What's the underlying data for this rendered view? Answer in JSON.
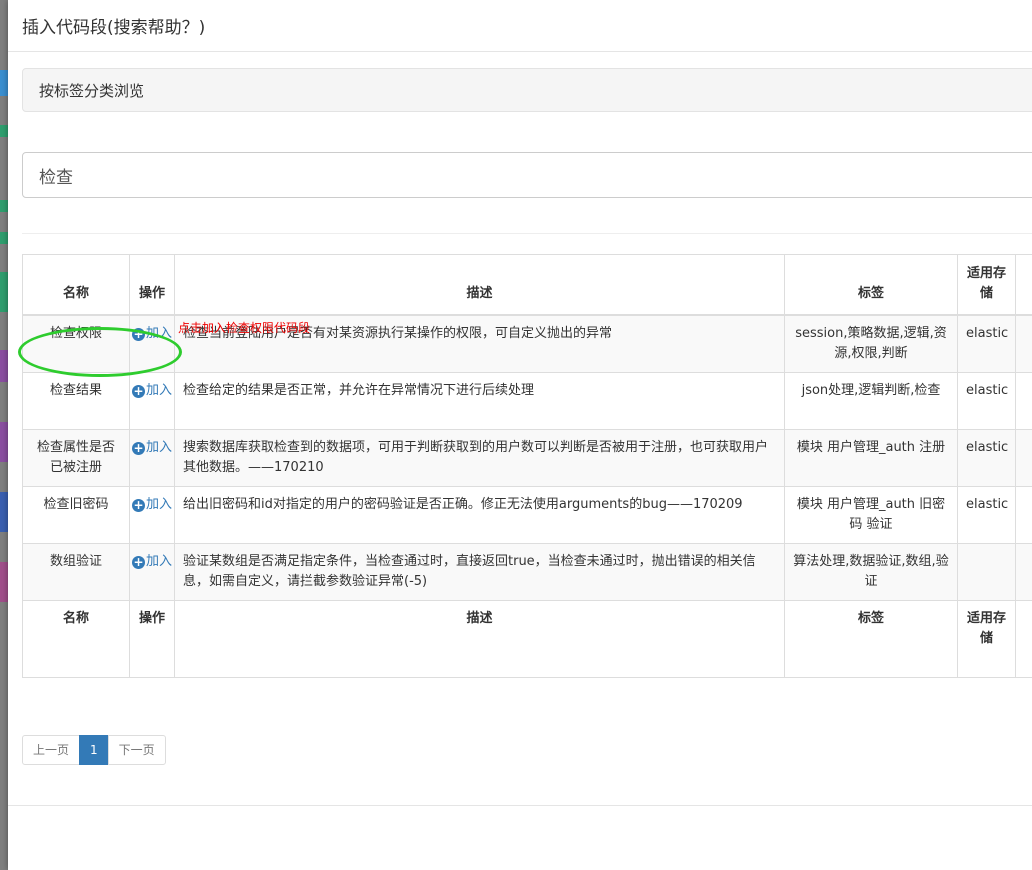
{
  "modal": {
    "title": "插入代码段(搜索帮助？)"
  },
  "tag_panel": {
    "label": "按标签分类浏览"
  },
  "search": {
    "value": "检查"
  },
  "table": {
    "headers": {
      "name": "名称",
      "op": "操作",
      "desc": "描述",
      "tags": "标签",
      "store": "适用存储"
    },
    "add_label": "加入",
    "rows": [
      {
        "name": "检查权限",
        "desc": "检查当前登陆用户是否有对某资源执行某操作的权限，可自定义抛出的异常",
        "tags": "session,策略数据,逻辑,资源,权限,判断",
        "store": "elastic"
      },
      {
        "name": "检查结果",
        "desc": "检查给定的结果是否正常，并允许在异常情况下进行后续处理",
        "tags": "json处理,逻辑判断,检查",
        "store": "elastic"
      },
      {
        "name": "检查属性是否已被注册",
        "desc": "搜索数据库获取检查到的数据项，可用于判断获取到的用户数可以判断是否被用于注册，也可获取用户其他数据。——170210",
        "tags": "模块 用户管理_auth 注册",
        "store": "elastic"
      },
      {
        "name": "检查旧密码",
        "desc": "给出旧密码和id对指定的用户的密码验证是否正确。修正无法使用arguments的bug——170209",
        "tags": "模块 用户管理_auth 旧密码 验证",
        "store": "elastic"
      },
      {
        "name": "数组验证",
        "desc": "验证某数组是否满足指定条件，当检查通过时，直接返回true，当检查未通过时，抛出错误的相关信息，如需自定义，请拦截参数验证异常(-5)",
        "tags": "算法处理,数据验证,数组,验证",
        "store": ""
      }
    ]
  },
  "annotation": {
    "hint": "点击加入检查权限代码段"
  },
  "pagination": {
    "prev": "上一页",
    "current": "1",
    "next": "下一页"
  },
  "colors": {
    "accent": "#337ab7",
    "highlight_ellipse": "#2ecc2e",
    "hint_text": "#ee0000"
  }
}
